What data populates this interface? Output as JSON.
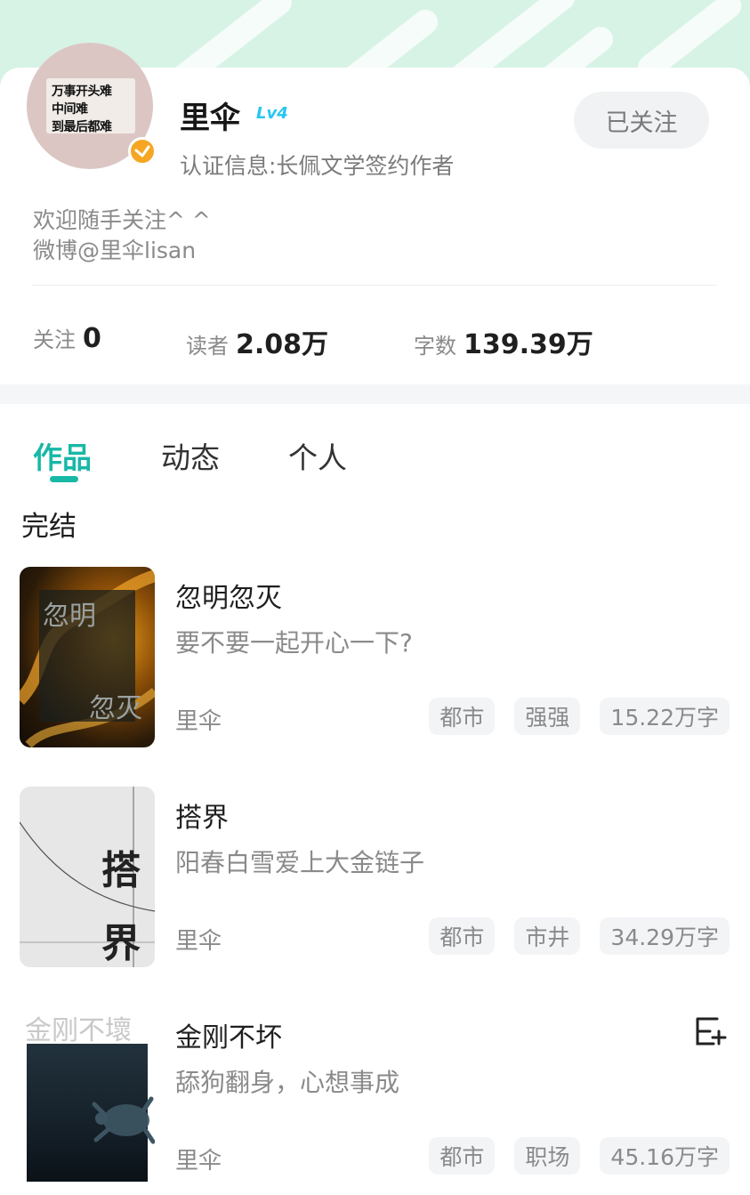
{
  "profile": {
    "avatar_lines": [
      "万事开头难",
      "中间难",
      "到最后都难"
    ],
    "name": "里伞",
    "level": "Lv4",
    "certification": "认证信息:长佩文学签约作者",
    "follow_button": "已关注",
    "bio_lines": [
      "欢迎随手关注^ ^",
      "微博@里伞lisan"
    ]
  },
  "stats": [
    {
      "label": "关注",
      "value": "0"
    },
    {
      "label": "读者",
      "value": "2.08万"
    },
    {
      "label": "字数",
      "value": "139.39万"
    }
  ],
  "tabs": [
    {
      "label": "作品",
      "active": true
    },
    {
      "label": "动态",
      "active": false
    },
    {
      "label": "个人",
      "active": false
    }
  ],
  "section_title": "完结",
  "books": [
    {
      "title": "忽明忽灭",
      "description": "要不要一起开心一下?",
      "author": "里伞",
      "tags": [
        "都市",
        "强强",
        "15.22万字"
      ],
      "cover_text": [
        "忽明",
        "忽灭"
      ],
      "cover_icon": "fire-cover"
    },
    {
      "title": "搭界",
      "description": "阳春白雪爱上大金链子",
      "author": "里伞",
      "tags": [
        "都市",
        "市井",
        "34.29万字"
      ],
      "cover_text": [
        "搭",
        "界"
      ],
      "cover_icon": "curve-cover"
    },
    {
      "title": "金刚不坏",
      "description": "舔狗翻身，心想事成",
      "author": "里伞",
      "tags": [
        "都市",
        "职场",
        "45.16万字"
      ],
      "cover_text": [
        "金刚不壞"
      ],
      "cover_icon": "turtle-cover",
      "action_icon": "add-to-shelf-icon"
    }
  ],
  "colors": {
    "accent": "#17b8a6",
    "band": "#d7f3e6",
    "badge": "#f6a623",
    "level": "#26c6f0"
  }
}
